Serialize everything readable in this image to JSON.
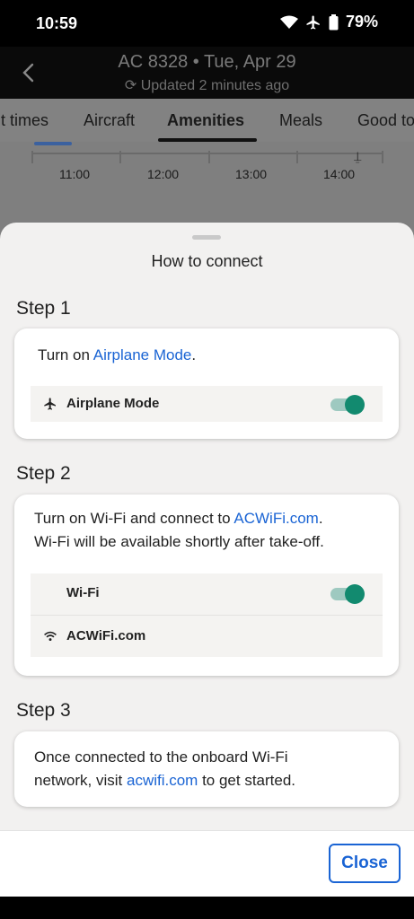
{
  "status_bar": {
    "time": "10:59",
    "battery": "79%",
    "icons": [
      "wifi-icon",
      "airplane-icon",
      "battery-icon"
    ]
  },
  "header": {
    "title": "AC 8328 • Tue, Apr 29",
    "subtitle": "Updated 2 minutes ago"
  },
  "tabs": [
    {
      "label": "it times"
    },
    {
      "label": "Aircraft"
    },
    {
      "label": "Amenities",
      "active": true
    },
    {
      "label": "Meals"
    },
    {
      "label": "Good to"
    }
  ],
  "timeline": {
    "labels": [
      "11:00",
      "12:00",
      "13:00",
      "14:00"
    ]
  },
  "sheet": {
    "title": "How to connect",
    "step1": {
      "label": "Step 1",
      "text_before": "Turn on ",
      "text_link": "Airplane Mode",
      "text_after": ".",
      "row_label": "Airplane Mode",
      "toggle_on": true
    },
    "step2": {
      "label": "Step 2",
      "text_before": "Turn on Wi-Fi and connect to ",
      "text_link": "ACWiFi.com",
      "text_after": ".",
      "text_line2": "Wi-Fi will be available shortly after take-off.",
      "wifi_row_label": "Wi-Fi",
      "network_row_label": "ACWiFi.com",
      "toggle_on": true
    },
    "step3": {
      "label": "Step 3",
      "text_line1": "Once connected to the onboard Wi-Fi",
      "text_before": "network, visit ",
      "text_link": "acwifi.com",
      "text_after": " to get started."
    }
  },
  "footer": {
    "close_label": "Close"
  },
  "colors": {
    "accent": "#1a64d4",
    "toggle": "#128a6f"
  }
}
